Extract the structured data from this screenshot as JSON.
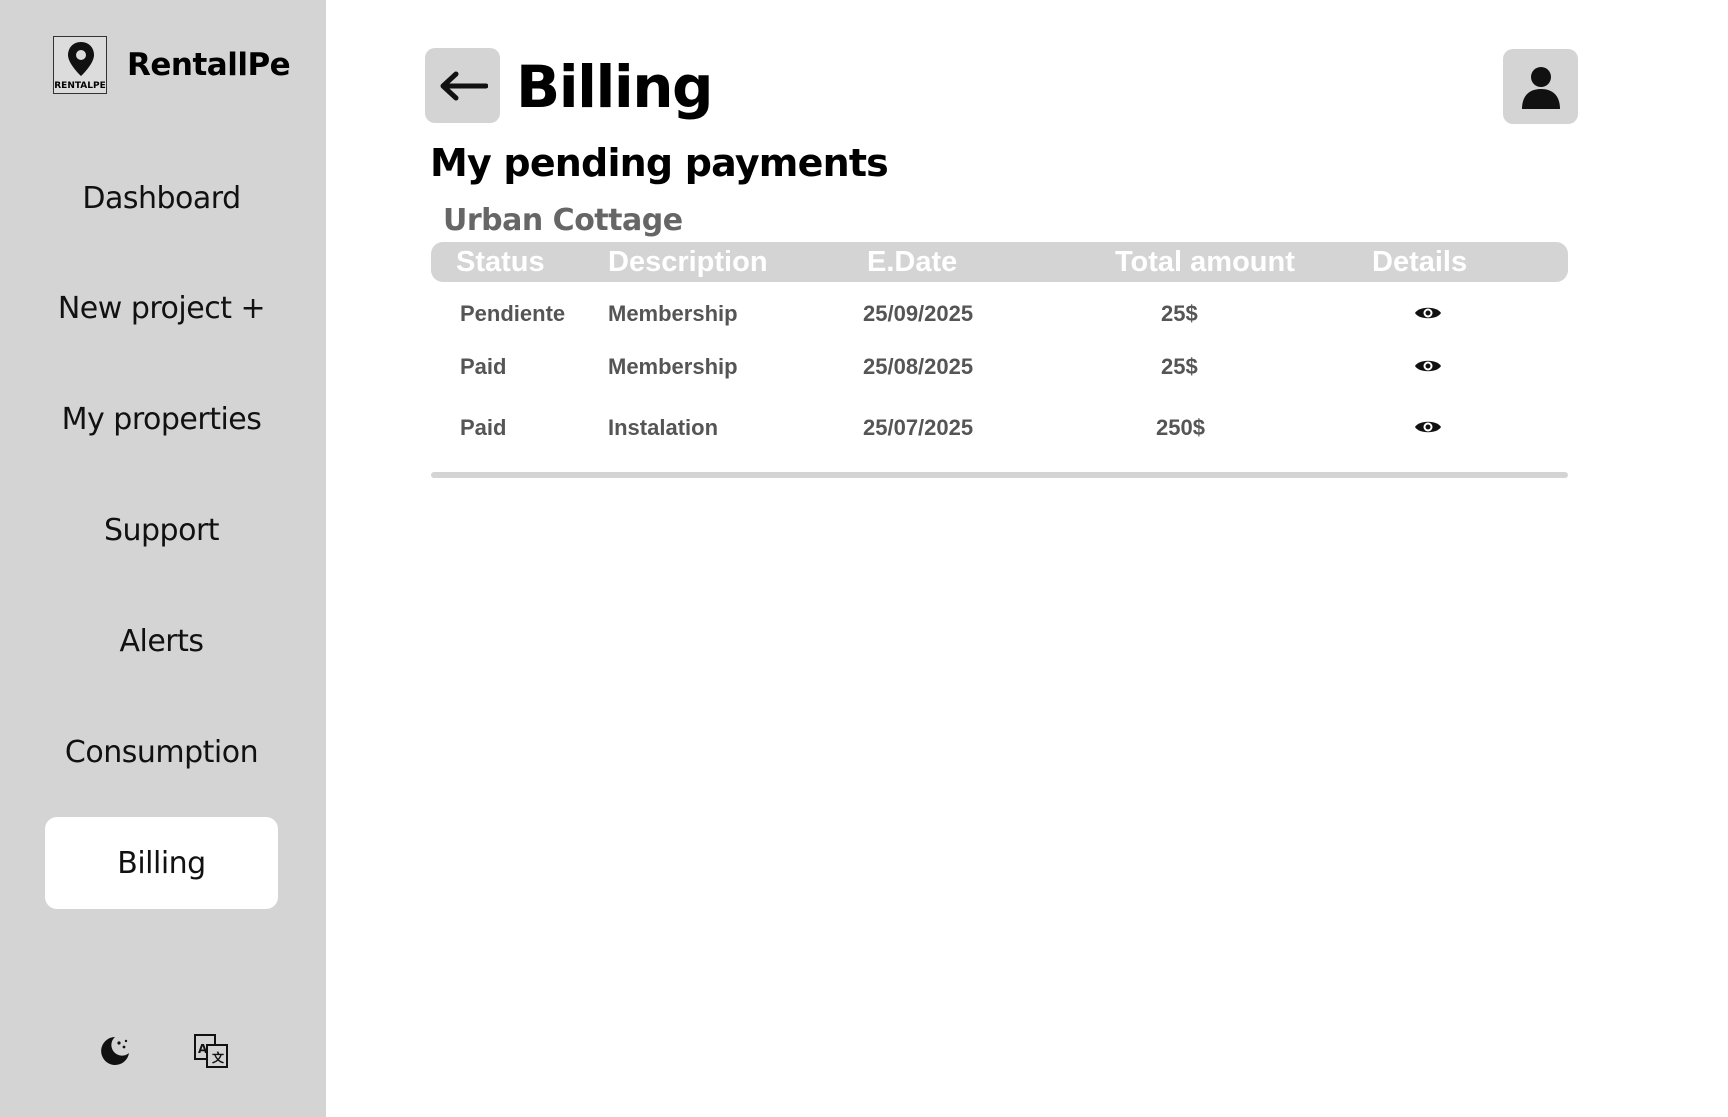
{
  "sidebar": {
    "brand_name": "RentallPe",
    "logo_caption": "RENTALPE",
    "items": [
      {
        "label": "Dashboard",
        "icon": "none"
      },
      {
        "label": "New project +",
        "icon": "none"
      },
      {
        "label": "My properties",
        "icon": "none"
      },
      {
        "label": "Support",
        "icon": "none"
      },
      {
        "label": "Alerts",
        "icon": "none"
      },
      {
        "label": "Consumption",
        "icon": "none"
      },
      {
        "label": "Billing",
        "icon": "none",
        "active": true
      }
    ],
    "bottom_icons": [
      "theme-toggle-icon",
      "translate-icon"
    ]
  },
  "header": {
    "title": "Billing",
    "back_icon": "arrow-left-icon",
    "profile_icon": "user-icon"
  },
  "main": {
    "section_title": "My pending payments",
    "property_name": "Urban Cottage",
    "table": {
      "columns": [
        "Status",
        "Description",
        "E.Date",
        "Total amount",
        "Details"
      ],
      "rows": [
        {
          "status": "Pendiente",
          "description": "Membership",
          "date": "25/09/2025",
          "amount": "25$",
          "details_icon": "eye-icon"
        },
        {
          "status": "Paid",
          "description": "Membership",
          "date": "25/08/2025",
          "amount": "25$",
          "details_icon": "eye-icon"
        },
        {
          "status": "Paid",
          "description": "Instalation",
          "date": "25/07/2025",
          "amount": "250$",
          "details_icon": "eye-icon"
        }
      ]
    }
  },
  "colors": {
    "sidebar_bg": "#d4d4d4",
    "active_item_bg": "#ffffff",
    "header_row_bg": "#d4d4d4",
    "muted_text": "#555555"
  }
}
